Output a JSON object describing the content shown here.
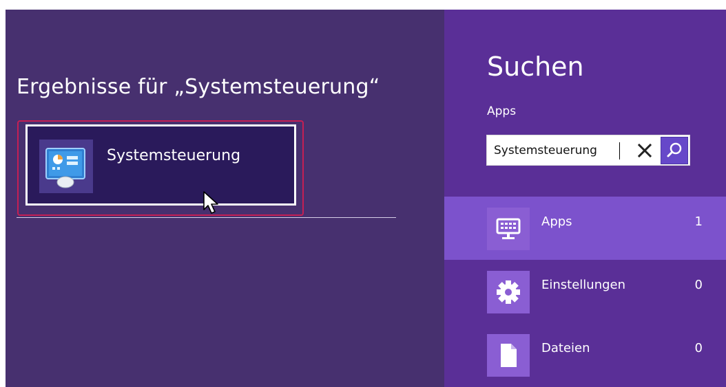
{
  "results": {
    "title": "Ergebnisse für „Systemsteuerung“",
    "items": [
      {
        "label": "Systemsteuerung",
        "icon": "control-panel-icon"
      }
    ]
  },
  "search_pane": {
    "title": "Suchen",
    "scope": "Apps",
    "query": "Systemsteuerung",
    "clear_icon": "close-icon",
    "search_icon": "search-icon",
    "categories": [
      {
        "label": "Apps",
        "count": "1",
        "icon": "apps-monitor-icon",
        "selected": true
      },
      {
        "label": "Einstellungen",
        "count": "0",
        "icon": "gear-icon",
        "selected": false
      },
      {
        "label": "Dateien",
        "count": "0",
        "icon": "file-icon",
        "selected": false
      }
    ]
  },
  "colors": {
    "background": "#47306f",
    "pane": "#5a2f97",
    "selected_category": "#7c52cc",
    "tile": "#2a1a5b",
    "tile_outline": "#c51f54",
    "search_button": "#6648c9"
  }
}
